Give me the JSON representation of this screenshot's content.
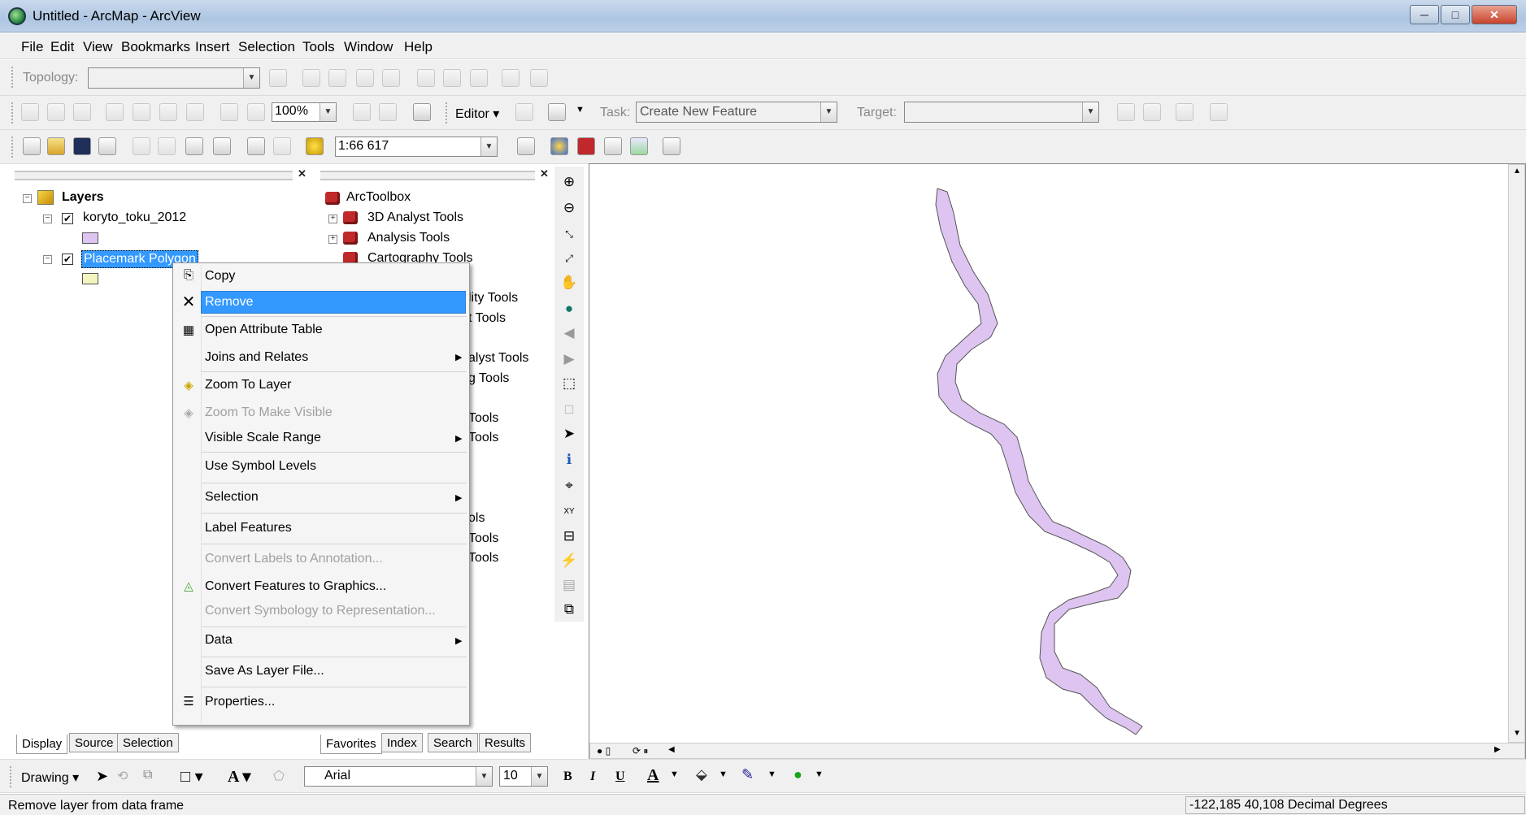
{
  "window": {
    "title": "Untitled - ArcMap - ArcView",
    "min": "─",
    "max": "□",
    "close": "✕"
  },
  "menubar": [
    "File",
    "Edit",
    "View",
    "Bookmarks",
    "Insert",
    "Selection",
    "Tools",
    "Window",
    "Help"
  ],
  "toolbar_topology": {
    "label": "Topology:",
    "value": ""
  },
  "toolbar_editor": {
    "zoom": "100%",
    "editor_label": "Editor",
    "task_label": "Task:",
    "task_value": "Create New Feature",
    "target_label": "Target:",
    "target_value": ""
  },
  "toolbar_standard": {
    "scale": "1:66 617"
  },
  "toc": {
    "root": "Layers",
    "layers": [
      {
        "name": "koryto_toku_2012",
        "checked": true,
        "swatch_color": "#ddc4f1"
      },
      {
        "name": "Placemark Polygon",
        "checked": true,
        "swatch_color": "#f3f5c0",
        "selected": true
      }
    ],
    "tabs": [
      "Display",
      "Source",
      "Selection"
    ]
  },
  "toolbox": {
    "root": "ArcToolbox",
    "items": [
      "3D Analyst Tools",
      "Analysis Tools",
      "Cartography Tools"
    ],
    "partial_items": [
      "lity Tools",
      "t Tools",
      "alyst Tools",
      "g Tools",
      "Tools",
      "Tools",
      "ols",
      "Tools",
      "Tools"
    ],
    "tabs": [
      "Favorites",
      "Index",
      "Search",
      "Results"
    ]
  },
  "context_menu": {
    "items": [
      {
        "label": "Copy",
        "disabled": false,
        "icon": "copy-icon"
      },
      {
        "label": "Remove",
        "disabled": false,
        "icon": "remove-x-icon",
        "highlighted": true
      },
      {
        "label": "Open Attribute Table",
        "disabled": false,
        "icon": "table-icon"
      },
      {
        "label": "Joins and Relates",
        "disabled": false,
        "submenu": true
      },
      {
        "label": "Zoom To Layer",
        "disabled": false,
        "icon": "zoom-to-layer-icon"
      },
      {
        "label": "Zoom To Make Visible",
        "disabled": true,
        "icon": "zoom-visible-icon"
      },
      {
        "label": "Visible Scale Range",
        "disabled": false,
        "submenu": true
      },
      {
        "label": "Use Symbol Levels",
        "disabled": false
      },
      {
        "label": "Selection",
        "disabled": false,
        "submenu": true
      },
      {
        "label": "Label Features",
        "disabled": false
      },
      {
        "label": "Convert Labels to Annotation...",
        "disabled": true
      },
      {
        "label": "Convert Features to Graphics...",
        "disabled": false,
        "icon": "convert-graphics-icon"
      },
      {
        "label": "Convert Symbology to Representation...",
        "disabled": true
      },
      {
        "label": "Data",
        "disabled": false,
        "submenu": true
      },
      {
        "label": "Save As Layer File...",
        "disabled": false
      },
      {
        "label": "Properties...",
        "disabled": false,
        "icon": "properties-icon"
      }
    ]
  },
  "drawing_toolbar": {
    "label": "Drawing",
    "font": "Arial",
    "font_size": "10",
    "bold": "B",
    "italic": "I",
    "underline": "U",
    "font_color_glyph": "A"
  },
  "map": {
    "polygon_fill": "#ddc4f1",
    "polygon_stroke": "#555555"
  },
  "statusbar": {
    "message": "Remove layer from data frame",
    "coordinates": "-122,185  40,108 Decimal Degrees"
  }
}
